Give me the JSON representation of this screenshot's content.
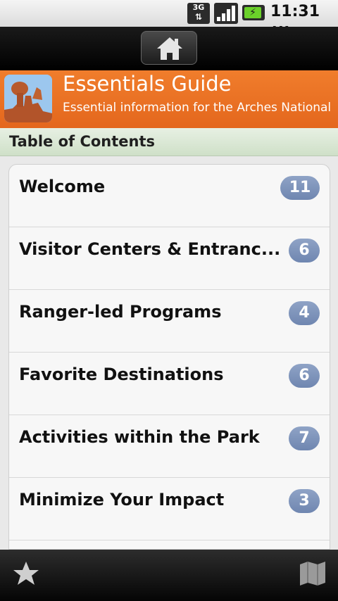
{
  "status": {
    "network": "3G",
    "battery_icon": "battery-charging-icon",
    "time": "11:31",
    "ampm": "AM"
  },
  "nav": {
    "home_icon": "home-icon"
  },
  "header": {
    "title": "Essentials Guide",
    "subtitle": "Essential information for the Arches National",
    "accent": "#e8701f"
  },
  "toc": {
    "heading": "Table of Contents"
  },
  "items": [
    {
      "label": "Welcome",
      "count": "11"
    },
    {
      "label": "Visitor Centers & Entranc...",
      "count": "6"
    },
    {
      "label": "Ranger-led Programs",
      "count": "4"
    },
    {
      "label": "Favorite Destinations",
      "count": "6"
    },
    {
      "label": "Activities within the Park",
      "count": "7"
    },
    {
      "label": "Minimize Your Impact",
      "count": "3"
    }
  ],
  "footer": {
    "left_icon": "star-icon",
    "right_icon": "map-icon"
  }
}
